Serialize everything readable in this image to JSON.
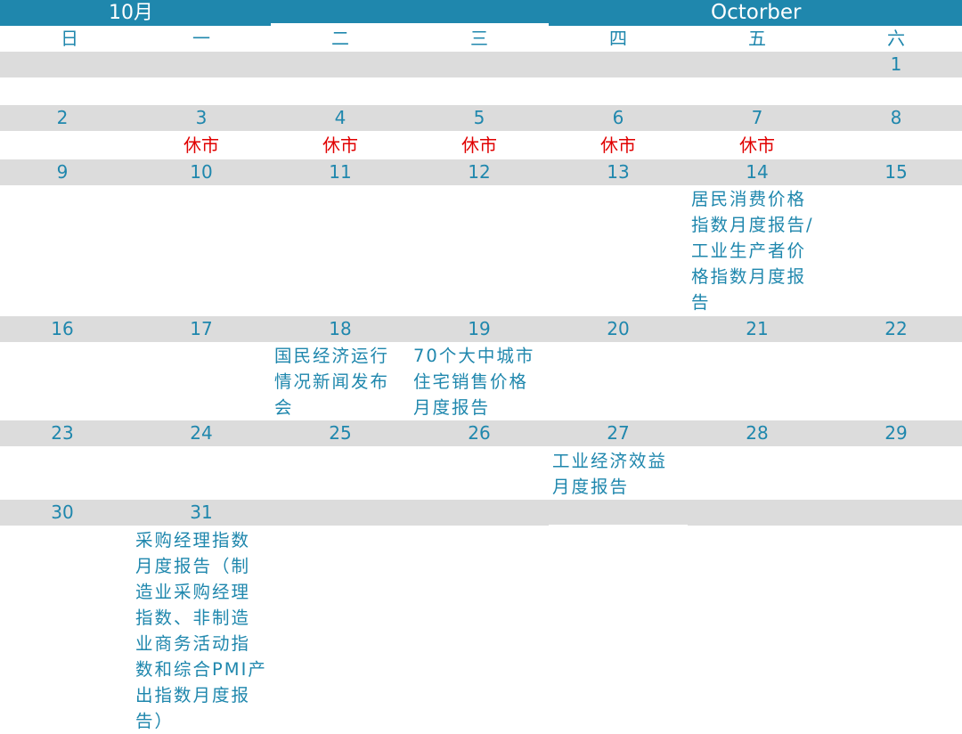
{
  "header": {
    "month_cn": "10月",
    "month_en": "Octorber"
  },
  "weekdays": [
    "日",
    "一",
    "二",
    "三",
    "四",
    "五",
    "六"
  ],
  "weeks": [
    {
      "days": [
        "",
        "",
        "",
        "",
        "",
        "",
        "1"
      ]
    },
    {
      "days": [
        "2",
        "3",
        "4",
        "5",
        "6",
        "7",
        "8"
      ],
      "holidays": [
        "",
        "休市",
        "休市",
        "休市",
        "休市",
        "休市",
        ""
      ]
    },
    {
      "days": [
        "9",
        "10",
        "11",
        "12",
        "13",
        "14",
        "15"
      ],
      "events": [
        "",
        "",
        "",
        "",
        "",
        "居民消费价格指数月度报告/工业生产者价格指数月度报告",
        ""
      ]
    },
    {
      "days": [
        "16",
        "17",
        "18",
        "19",
        "20",
        "21",
        "22"
      ],
      "events": [
        "",
        "",
        "国民经济运行情况新闻发布会",
        "70个大中城市住宅销售价格月度报告",
        "",
        "",
        ""
      ]
    },
    {
      "days": [
        "23",
        "24",
        "25",
        "26",
        "27",
        "28",
        "29"
      ],
      "events": [
        "",
        "",
        "",
        "",
        "工业经济效益月度报告",
        "",
        ""
      ]
    },
    {
      "days": [
        "30",
        "31",
        "",
        "",
        "",
        "",
        ""
      ],
      "events": [
        "",
        "采购经理指数月度报告（制造业采购经理指数、非制造业商务活动指数和综合PMI产出指数月度报告）",
        "",
        "",
        "",
        "",
        ""
      ]
    }
  ],
  "colors": {
    "accent": "#1f87ad",
    "band": "#dcdcdc",
    "holiday": "#e00000"
  }
}
